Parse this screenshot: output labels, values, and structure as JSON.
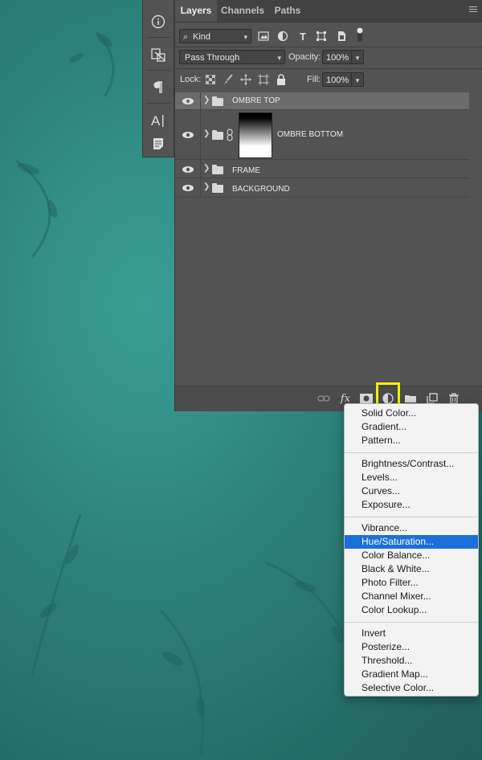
{
  "tabs": [
    "Layers",
    "Channels",
    "Paths"
  ],
  "filter": {
    "kind_label": "Kind"
  },
  "blend": {
    "mode": "Pass Through",
    "opacity_label": "Opacity:",
    "opacity_value": "100%"
  },
  "lock": {
    "label": "Lock:",
    "fill_label": "Fill:",
    "fill_value": "100%"
  },
  "layers": [
    {
      "name": "OMBRE TOP",
      "selected": true
    },
    {
      "name": "OMBRE BOTTOM",
      "has_mask": true
    },
    {
      "name": "FRAME"
    },
    {
      "name": "BACKGROUND"
    }
  ],
  "footer_icons": [
    "link-icon",
    "fx-icon",
    "mask-icon",
    "adjustment-icon",
    "group-folder-icon",
    "new-layer-icon",
    "trash-icon"
  ],
  "menu": {
    "group1": [
      "Solid Color...",
      "Gradient...",
      "Pattern..."
    ],
    "group2": [
      "Brightness/Contrast...",
      "Levels...",
      "Curves...",
      "Exposure..."
    ],
    "group3": [
      "Vibrance...",
      "Hue/Saturation...",
      "Color Balance...",
      "Black & White...",
      "Photo Filter...",
      "Channel Mixer...",
      "Color Lookup..."
    ],
    "group4": [
      "Invert",
      "Posterize...",
      "Threshold...",
      "Gradient Map...",
      "Selective Color..."
    ],
    "highlighted": "Hue/Saturation..."
  },
  "colors": {
    "highlight_box": "#f3f000",
    "menu_selection": "#1c6fd9"
  }
}
